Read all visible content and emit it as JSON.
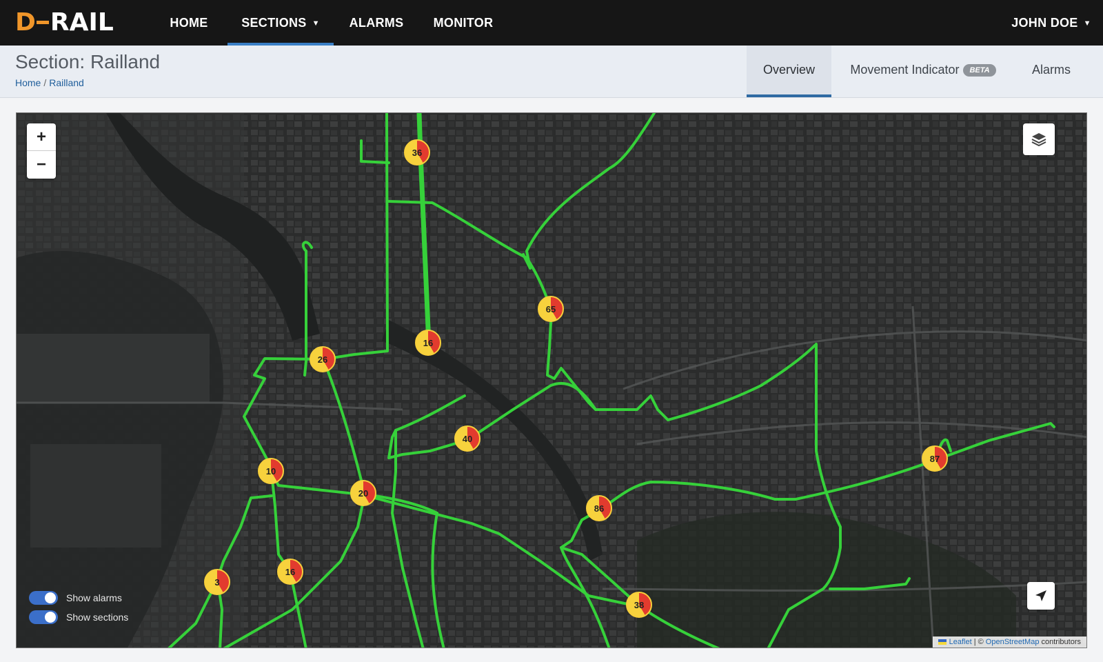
{
  "app": {
    "logo_prefix": "D",
    "logo_text": "RAIL",
    "brand_color": "#f0962a"
  },
  "nav": {
    "home": "HOME",
    "sections": "SECTIONS",
    "alarms": "ALARMS",
    "monitor": "MONITOR",
    "user": "JOHN DOE"
  },
  "page": {
    "title": "Section: Railland",
    "breadcrumb": {
      "home": "Home",
      "separator": "/",
      "current": "Railland"
    }
  },
  "tabs": {
    "overview": "Overview",
    "movement": "Movement Indicator",
    "movement_badge": "BETA",
    "alarms": "Alarms"
  },
  "map": {
    "zoom_in": "+",
    "zoom_out": "−",
    "markers": [
      "36",
      "65",
      "16",
      "26",
      "40",
      "10",
      "20",
      "86",
      "87",
      "16",
      "3",
      "38"
    ],
    "toggles": {
      "alarms": "Show alarms",
      "sections": "Show sections"
    },
    "attribution": {
      "leaflet": "Leaflet",
      "sep": "| ©",
      "osm": "OpenStreetMap",
      "suffix": "contributors"
    },
    "route_color": "#36d13a",
    "marker_colors": {
      "alarm": "#e23b2e",
      "ok": "#f7d23d"
    }
  }
}
